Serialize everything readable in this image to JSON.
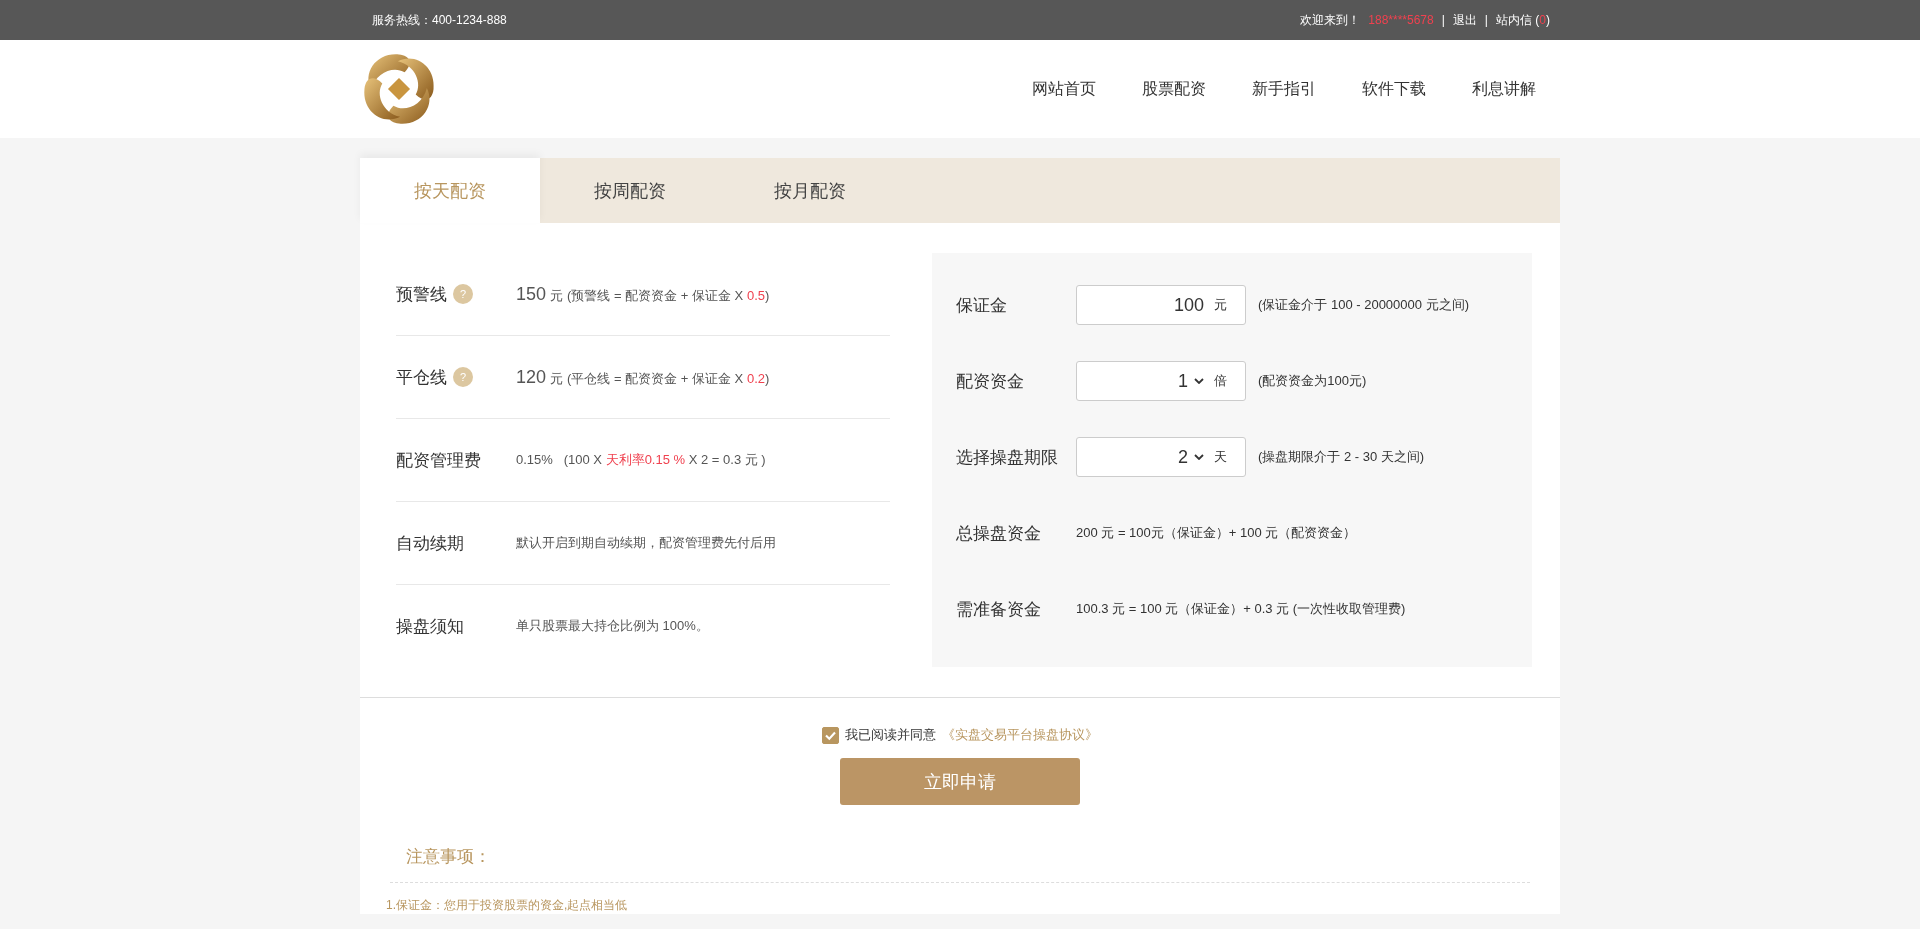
{
  "top_bar": {
    "hotline": "服务热线：400-1234-888",
    "welcome": "欢迎来到！",
    "user": "188****5678",
    "separators": [
      "|",
      "|"
    ],
    "logout": "退出",
    "messages_label": "站内信 (",
    "messages_count": "0",
    "messages_close": ")"
  },
  "nav": [
    {
      "label": "网站首页"
    },
    {
      "label": "股票配资"
    },
    {
      "label": "新手指引"
    },
    {
      "label": "软件下载"
    },
    {
      "label": "利息讲解"
    }
  ],
  "tabs": [
    {
      "label": "按天配资",
      "selected": true
    },
    {
      "label": "按周配资",
      "selected": false
    },
    {
      "label": "按月配资",
      "selected": false
    }
  ],
  "info_rows": [
    {
      "label": "预警线",
      "help": "?",
      "amount": "150",
      "unit": "元",
      "formula": [
        {
          "text": "(预警线 = 配资资金 + 保证金 X ",
          "emphasis": false
        },
        {
          "text": "0.5",
          "emphasis": true
        },
        {
          "text": ")",
          "emphasis": false
        }
      ]
    },
    {
      "label": "平仓线",
      "help": "?",
      "amount": "120",
      "unit": "元",
      "formula": [
        {
          "text": "(平仓线 = 配资资金 + 保证金 X ",
          "emphasis": false
        },
        {
          "text": "0.2",
          "emphasis": true
        },
        {
          "text": ")",
          "emphasis": false
        }
      ]
    },
    {
      "label": "配资管理费",
      "formula": [
        {
          "text": "0.15%   (100 X ",
          "emphasis": false
        },
        {
          "text": "天利率0.15 %",
          "emphasis": true
        },
        {
          "text": " X 2 = 0.3 元 )",
          "emphasis": false
        }
      ]
    },
    {
      "label": "自动续期",
      "formula": [
        {
          "text": "默认开启到期自动续期，配资管理费先付后用",
          "emphasis": false
        }
      ]
    },
    {
      "label": "操盘须知",
      "formula": [
        {
          "text": "单只股票最大持仓比例为 100%。",
          "emphasis": false
        }
      ]
    }
  ],
  "form_rows": [
    {
      "kind": "input",
      "label": "保证金",
      "value": "100",
      "unit": "元",
      "hint": "(保证金介于 100 - 20000000 元之间)"
    },
    {
      "kind": "select",
      "label": "配资资金",
      "value": "1",
      "unit": "倍",
      "hint": "(配资资金为100元)"
    },
    {
      "kind": "select",
      "label": "选择操盘期限",
      "value": "2",
      "unit": "天",
      "hint": "(操盘期限介于 2 - 30 天之间)"
    },
    {
      "kind": "text",
      "label": "总操盘资金",
      "hint": "200 元 = 100元（保证金）+ 100 元（配资资金）"
    },
    {
      "kind": "text",
      "label": "需准备资金",
      "hint": "100.3 元 = 100 元（保证金）+ 0.3 元 (一次性收取管理费)"
    }
  ],
  "agreement": {
    "checked": true,
    "text": "我已阅读并同意",
    "link": "《实盘交易平台操盘协议》"
  },
  "submit": "立即申请",
  "notes": {
    "title": "注意事项：",
    "items": [
      "1.保证金：您用于投资股票的资金,起点相当低"
    ]
  }
}
